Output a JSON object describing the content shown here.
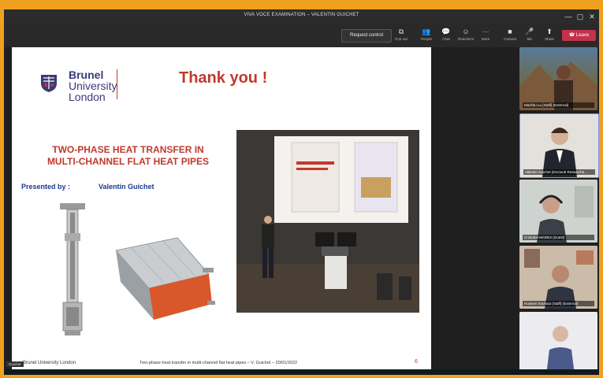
{
  "window": {
    "title": "VIVA VOCE EXAMINATION – VALENTIN GUICHET",
    "controls": [
      "—",
      "▢",
      "✕"
    ]
  },
  "toolbar": {
    "request_control": "Request control",
    "buttons": [
      {
        "icon": "pop-out-icon",
        "glyph": "⧉",
        "label": "Pop out"
      },
      {
        "icon": "people-icon",
        "glyph": "👥",
        "label": "People"
      },
      {
        "icon": "chat-icon",
        "glyph": "💬",
        "label": "Chat"
      },
      {
        "icon": "reactions-icon",
        "glyph": "☺",
        "label": "Reactions"
      },
      {
        "icon": "more-icon",
        "glyph": "···",
        "label": "More"
      },
      {
        "icon": "camera-icon",
        "glyph": "■",
        "label": "Camera"
      },
      {
        "icon": "mic-icon",
        "glyph": "🎤",
        "label": "Mic"
      },
      {
        "icon": "share-icon",
        "glyph": "⬆",
        "label": "Share"
      }
    ],
    "leave": "Leave",
    "leave_icon": "phone-icon",
    "leave_glyph": "☎"
  },
  "slide": {
    "logo": {
      "line1": "Brunel",
      "line2": "University",
      "line3": "London"
    },
    "thanks": "Thank you !",
    "title_line1": "TWO-PHASE HEAT TRANSFER IN",
    "title_line2": "MULTI-CHANNEL FLAT HEAT PIPES",
    "presented_by_label": "Presented by :",
    "presenter": "Valentin Guichet",
    "footer_left": "Brunel University London",
    "footer_center": "Two-phase heat transfer in multi-channel flat heat pipes – V. Guichet – 20/01/2022",
    "page_number": "6"
  },
  "participants": [
    {
      "name": "Mazhitu Lu (Staff) (External)"
    },
    {
      "name": "Valentin Guichet (Doctoral Researche..."
    },
    {
      "name": "Cristobal MARES (Guest)"
    },
    {
      "name": "Hussein Souhaia (Staff) (External)"
    },
    {
      "name": ""
    }
  ],
  "user_tag": "Guichet",
  "colors": {
    "frame_border": "#f0a020",
    "leave": "#c4314b",
    "slide_red": "#c0392b",
    "slide_blue": "#1a3a8a"
  }
}
